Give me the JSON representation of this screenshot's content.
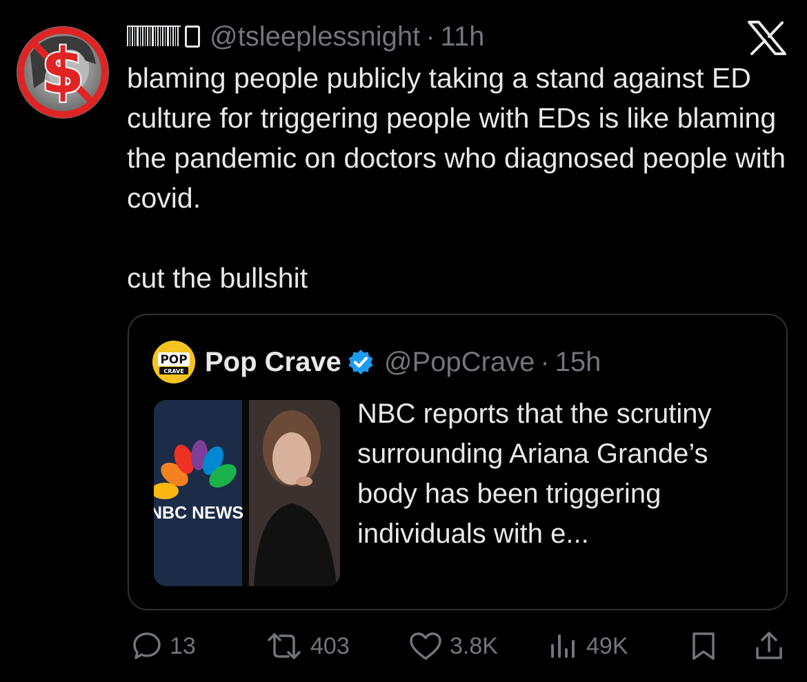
{
  "tweet": {
    "display_name_icon": "barcode-glyph",
    "handle": "@tsleeplessnight",
    "separator": "·",
    "time": "11h",
    "platform_icon": "x-logo-icon",
    "body_lines": [
      "blaming people publicly taking a stand against ED culture for triggering people with EDs is like blaming the pandemic on doctors who diagnosed people with covid.",
      "cut the bullshit"
    ]
  },
  "quote": {
    "name": "Pop Crave",
    "handle": "@PopCrave",
    "separator": "·",
    "time": "15h",
    "logo_text_top": "POP",
    "logo_text_bottom": "CRAVE",
    "media_label": "NBC NEWS",
    "text": "NBC reports that the scrutiny surrounding Ariana Grande’s body has been triggering individuals with e..."
  },
  "actions": {
    "replies": "13",
    "reposts": "403",
    "likes": "3.8K",
    "views": "49K"
  },
  "colors": {
    "background": "#000000",
    "text": "#e7e9ea",
    "muted": "#71767b",
    "verified": "#1d9bf0",
    "border": "#2f3336"
  }
}
